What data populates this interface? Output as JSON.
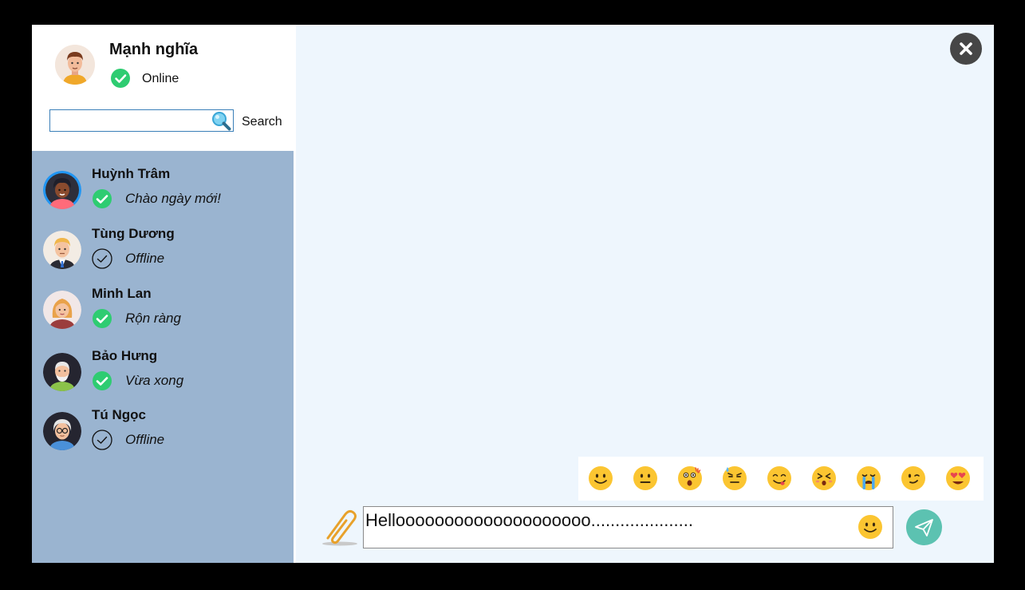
{
  "user": {
    "name": "Mạnh nghĩa",
    "status": "Online"
  },
  "search": {
    "placeholder": "",
    "value": "",
    "label": "Search"
  },
  "contacts": [
    {
      "name": "Huỳnh Trâm",
      "status": "Chào ngày mới!",
      "online": true
    },
    {
      "name": "Tùng Dương",
      "status": "Offline",
      "online": false
    },
    {
      "name": "Minh Lan",
      "status": "Rộn ràng",
      "online": true
    },
    {
      "name": "Bảo Hưng",
      "status": "Vừa xong",
      "online": true
    },
    {
      "name": "Tú Ngọc",
      "status": "Offline",
      "online": false
    }
  ],
  "composer": {
    "message": "Helloooooooooooooooooooo....................."
  },
  "emojis": [
    "smile-emoji",
    "neutral-emoji",
    "surprised-emoji",
    "sweat-emoji",
    "yum-emoji",
    "dizzy-emoji",
    "crying-emoji",
    "wink-emoji",
    "heart-eyes-emoji"
  ],
  "icons": {
    "close": "close-icon",
    "attach": "paperclip-icon",
    "send": "send-icon",
    "search": "magnifier-icon"
  },
  "colors": {
    "sidebar_bg": "#ffffff",
    "contacts_bg": "#9ab4d0",
    "chat_bg": "#eef6fd",
    "online": "#2ecc71",
    "send": "#5cc2b1",
    "close": "#464646"
  }
}
